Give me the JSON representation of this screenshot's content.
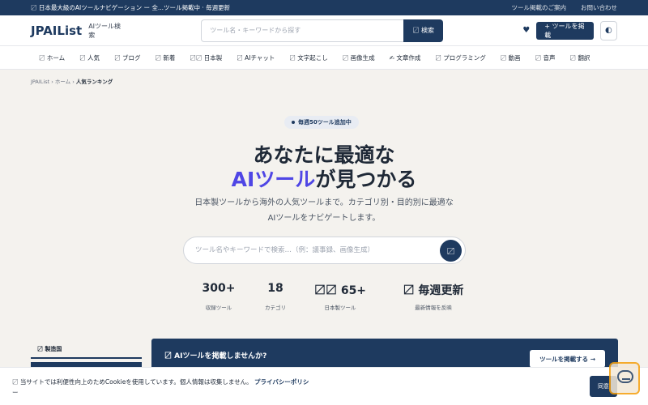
{
  "topbar": {
    "left": "〼 日本最大級のAIツールナビゲーション ー 全...ツール掲載中 · 毎週更新",
    "links": [
      "ツール掲載のご案内",
      "お問い合わせ"
    ]
  },
  "header": {
    "logo": "JPAIList",
    "logo_sub": "AIツール検索",
    "search_placeholder": "ツール名・キーワードから探す",
    "search_button": "〼 検索",
    "heart_icon": "♥",
    "post_button": "+ ツールを掲載",
    "theme_icon": "◐"
  },
  "nav": {
    "items": [
      "〼 ホーム",
      "〼 人気",
      "〼 ブログ",
      "〼 新着",
      "〼〼 日本製",
      "〼 AIチャット",
      "〼 文字起こし",
      "〼 画像生成",
      "✍ 文章作成",
      "〼 プログラミング",
      "〼 動画",
      "〼 音声",
      "〼 翻訳"
    ]
  },
  "breadcrumb": {
    "path": "JPAIList › ホーム › ",
    "current": "人気ランキング"
  },
  "hero": {
    "badge": "毎週50ツール追加中",
    "title_line1": "あなたに最適な",
    "title_accent": "AIツール",
    "title_line2_rest": "が見つかる",
    "lead_line1": "日本製ツールから海外の人気ツールまで。カテゴリ別・目的別に最適な",
    "lead_line2": "AIツールをナビゲートします。",
    "search_placeholder": "ツール名やキーワードで検索…（例：議事録、画像生成）",
    "search_icon": "〼"
  },
  "stats": [
    {
      "value": "300+",
      "label": "収録ツール"
    },
    {
      "value": "18",
      "label": "カテゴリ"
    },
    {
      "value": "〼〼 65+",
      "label": "日本製ツール"
    },
    {
      "value": "〼 毎週更新",
      "label": "最新情報を反映"
    }
  ],
  "sidebar": {
    "heading": "〼 製造国"
  },
  "promo": {
    "title": "〼 AIツールを掲載しませんか?",
    "button": "ツールを掲載する →"
  },
  "cookie": {
    "message": "〼 当サイトでは利便性向上のためCookieを使用しています。個人情報は収集しません。",
    "policy_link": "プライバシーポリシ",
    "message_tail": "ー",
    "agree_button": "同意"
  },
  "colors": {
    "brand": "#1e3a5f",
    "accent": "#4f46e5",
    "background": "#f4f2ee"
  }
}
